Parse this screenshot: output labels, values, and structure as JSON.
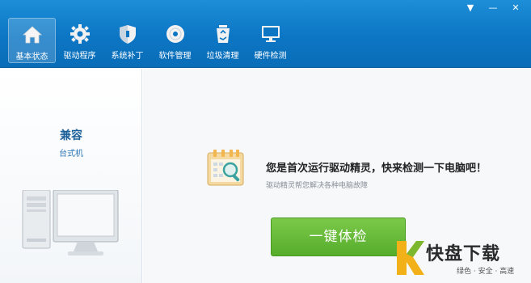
{
  "window": {
    "controls": [
      "▼",
      "—",
      "✕"
    ]
  },
  "toolbar": {
    "items": [
      {
        "label": "基本状态",
        "icon": "home-icon",
        "active": true
      },
      {
        "label": "驱动程序",
        "icon": "gear-icon"
      },
      {
        "label": "系统补丁",
        "icon": "shield-icon"
      },
      {
        "label": "软件管理",
        "icon": "disc-icon"
      },
      {
        "label": "垃圾清理",
        "icon": "recycle-bin-icon"
      },
      {
        "label": "硬件检测",
        "icon": "monitor-icon"
      }
    ]
  },
  "left": {
    "pc_name": "兼容",
    "pc_type": "台式机"
  },
  "main": {
    "headline": "您是首次运行驱动精灵，快来检测一下电脑吧！",
    "subline": "驱动精灵帮您解决各种电脑故障",
    "check_button": "一键体检"
  },
  "watermark": {
    "logo_text": "快盘下载",
    "slogan": "绿色 · 安全 · 高速"
  },
  "colors": {
    "topbar": "#0c76c4",
    "button": "#56ad2b"
  }
}
